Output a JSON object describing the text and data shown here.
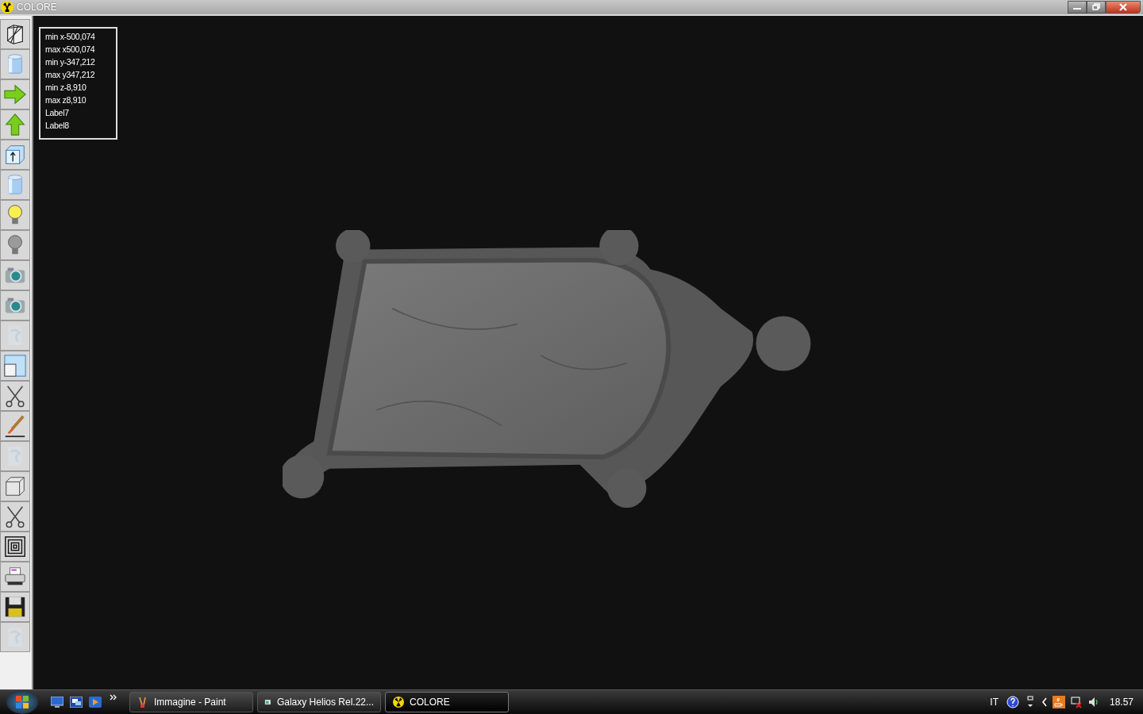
{
  "window": {
    "title": "COLORE"
  },
  "toolbar": [
    {
      "kind": "wireframe",
      "disabled": false
    },
    {
      "kind": "cylinder",
      "disabled": false
    },
    {
      "kind": "arrow-right",
      "disabled": false
    },
    {
      "kind": "arrow-up",
      "disabled": false
    },
    {
      "kind": "box-arrow",
      "disabled": false
    },
    {
      "kind": "cylinder",
      "disabled": false
    },
    {
      "kind": "bulb-on",
      "disabled": false
    },
    {
      "kind": "bulb-off",
      "disabled": false
    },
    {
      "kind": "camera",
      "disabled": false
    },
    {
      "kind": "camera",
      "disabled": false
    },
    {
      "kind": "texture",
      "disabled": true
    },
    {
      "kind": "window",
      "disabled": false
    },
    {
      "kind": "scissors",
      "disabled": false
    },
    {
      "kind": "brush",
      "disabled": false
    },
    {
      "kind": "texture",
      "disabled": true
    },
    {
      "kind": "cube",
      "disabled": false
    },
    {
      "kind": "scissors",
      "disabled": false
    },
    {
      "kind": "squares",
      "disabled": false
    },
    {
      "kind": "printer",
      "disabled": false
    },
    {
      "kind": "floppy",
      "disabled": false
    },
    {
      "kind": "texture",
      "disabled": true
    }
  ],
  "info_labels": [
    "min x-500,074",
    "max x500,074",
    "min y-347,212",
    "max y347,212",
    "min z-8,910",
    "max z8,910",
    "Label7",
    "Label8"
  ],
  "taskbar": {
    "tasks": [
      {
        "label": "Immagine - Paint",
        "kind": "paint",
        "selected": false
      },
      {
        "label": "Galaxy Helios  Rel.22...",
        "kind": "helios",
        "selected": false
      },
      {
        "label": "COLORE",
        "kind": "colore",
        "selected": true
      }
    ],
    "language": "IT",
    "clock": "18.57"
  }
}
